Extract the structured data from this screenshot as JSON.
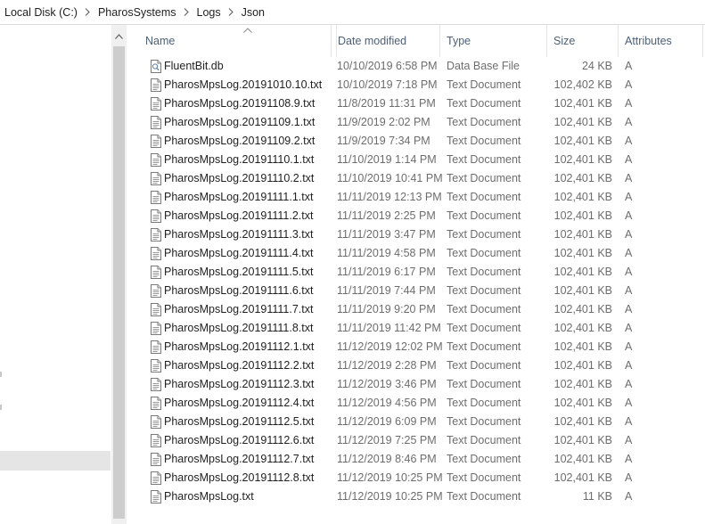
{
  "breadcrumb": {
    "items": [
      {
        "label": "Local Disk (C:)"
      },
      {
        "label": "PharosSystems"
      },
      {
        "label": "Logs"
      },
      {
        "label": "Json"
      }
    ]
  },
  "columns": {
    "name": "Name",
    "date": "Date modified",
    "type": "Type",
    "size": "Size",
    "attributes": "Attributes",
    "sorted_by": "Name",
    "sort_direction": "ascending"
  },
  "files": [
    {
      "name": "FluentBit.db",
      "date": "10/10/2019 6:58 PM",
      "type": "Data Base File",
      "size": "24 KB",
      "attr": "A",
      "icon": "database-file-icon"
    },
    {
      "name": "PharosMpsLog.20191010.10.txt",
      "date": "10/10/2019 7:18 PM",
      "type": "Text Document",
      "size": "102,402 KB",
      "attr": "A",
      "icon": "text-file-icon"
    },
    {
      "name": "PharosMpsLog.20191108.9.txt",
      "date": "11/8/2019 11:31 PM",
      "type": "Text Document",
      "size": "102,401 KB",
      "attr": "A",
      "icon": "text-file-icon"
    },
    {
      "name": "PharosMpsLog.20191109.1.txt",
      "date": "11/9/2019 2:02 PM",
      "type": "Text Document",
      "size": "102,401 KB",
      "attr": "A",
      "icon": "text-file-icon"
    },
    {
      "name": "PharosMpsLog.20191109.2.txt",
      "date": "11/9/2019 7:34 PM",
      "type": "Text Document",
      "size": "102,401 KB",
      "attr": "A",
      "icon": "text-file-icon"
    },
    {
      "name": "PharosMpsLog.20191110.1.txt",
      "date": "11/10/2019 1:14 PM",
      "type": "Text Document",
      "size": "102,401 KB",
      "attr": "A",
      "icon": "text-file-icon"
    },
    {
      "name": "PharosMpsLog.20191110.2.txt",
      "date": "11/10/2019 10:41 PM",
      "type": "Text Document",
      "size": "102,401 KB",
      "attr": "A",
      "icon": "text-file-icon"
    },
    {
      "name": "PharosMpsLog.20191111.1.txt",
      "date": "11/11/2019 12:13 PM",
      "type": "Text Document",
      "size": "102,401 KB",
      "attr": "A",
      "icon": "text-file-icon"
    },
    {
      "name": "PharosMpsLog.20191111.2.txt",
      "date": "11/11/2019 2:25 PM",
      "type": "Text Document",
      "size": "102,401 KB",
      "attr": "A",
      "icon": "text-file-icon"
    },
    {
      "name": "PharosMpsLog.20191111.3.txt",
      "date": "11/11/2019 3:47 PM",
      "type": "Text Document",
      "size": "102,401 KB",
      "attr": "A",
      "icon": "text-file-icon"
    },
    {
      "name": "PharosMpsLog.20191111.4.txt",
      "date": "11/11/2019 4:58 PM",
      "type": "Text Document",
      "size": "102,401 KB",
      "attr": "A",
      "icon": "text-file-icon"
    },
    {
      "name": "PharosMpsLog.20191111.5.txt",
      "date": "11/11/2019 6:17 PM",
      "type": "Text Document",
      "size": "102,401 KB",
      "attr": "A",
      "icon": "text-file-icon"
    },
    {
      "name": "PharosMpsLog.20191111.6.txt",
      "date": "11/11/2019 7:44 PM",
      "type": "Text Document",
      "size": "102,401 KB",
      "attr": "A",
      "icon": "text-file-icon"
    },
    {
      "name": "PharosMpsLog.20191111.7.txt",
      "date": "11/11/2019 9:20 PM",
      "type": "Text Document",
      "size": "102,401 KB",
      "attr": "A",
      "icon": "text-file-icon"
    },
    {
      "name": "PharosMpsLog.20191111.8.txt",
      "date": "11/11/2019 11:42 PM",
      "type": "Text Document",
      "size": "102,401 KB",
      "attr": "A",
      "icon": "text-file-icon"
    },
    {
      "name": "PharosMpsLog.20191112.1.txt",
      "date": "11/12/2019 12:02 PM",
      "type": "Text Document",
      "size": "102,401 KB",
      "attr": "A",
      "icon": "text-file-icon"
    },
    {
      "name": "PharosMpsLog.20191112.2.txt",
      "date": "11/12/2019 2:28 PM",
      "type": "Text Document",
      "size": "102,401 KB",
      "attr": "A",
      "icon": "text-file-icon"
    },
    {
      "name": "PharosMpsLog.20191112.3.txt",
      "date": "11/12/2019 3:46 PM",
      "type": "Text Document",
      "size": "102,401 KB",
      "attr": "A",
      "icon": "text-file-icon"
    },
    {
      "name": "PharosMpsLog.20191112.4.txt",
      "date": "11/12/2019 4:56 PM",
      "type": "Text Document",
      "size": "102,401 KB",
      "attr": "A",
      "icon": "text-file-icon"
    },
    {
      "name": "PharosMpsLog.20191112.5.txt",
      "date": "11/12/2019 6:09 PM",
      "type": "Text Document",
      "size": "102,401 KB",
      "attr": "A",
      "icon": "text-file-icon"
    },
    {
      "name": "PharosMpsLog.20191112.6.txt",
      "date": "11/12/2019 7:25 PM",
      "type": "Text Document",
      "size": "102,401 KB",
      "attr": "A",
      "icon": "text-file-icon"
    },
    {
      "name": "PharosMpsLog.20191112.7.txt",
      "date": "11/12/2019 8:46 PM",
      "type": "Text Document",
      "size": "102,401 KB",
      "attr": "A",
      "icon": "text-file-icon"
    },
    {
      "name": "PharosMpsLog.20191112.8.txt",
      "date": "11/12/2019 10:25 PM",
      "type": "Text Document",
      "size": "102,401 KB",
      "attr": "A",
      "icon": "text-file-icon"
    },
    {
      "name": "PharosMpsLog.txt",
      "date": "11/12/2019 10:25 PM",
      "type": "Text Document",
      "size": "11 KB",
      "attr": "A",
      "icon": "text-file-icon"
    }
  ],
  "colors": {
    "header_text": "#4c607a",
    "secondary_text": "#6d6d6d",
    "primary_text": "#1f1f1f",
    "nav_selected": "#e5e5e5",
    "scroll_track": "#f0f0f0",
    "scroll_thumb": "#cdcdcd"
  }
}
